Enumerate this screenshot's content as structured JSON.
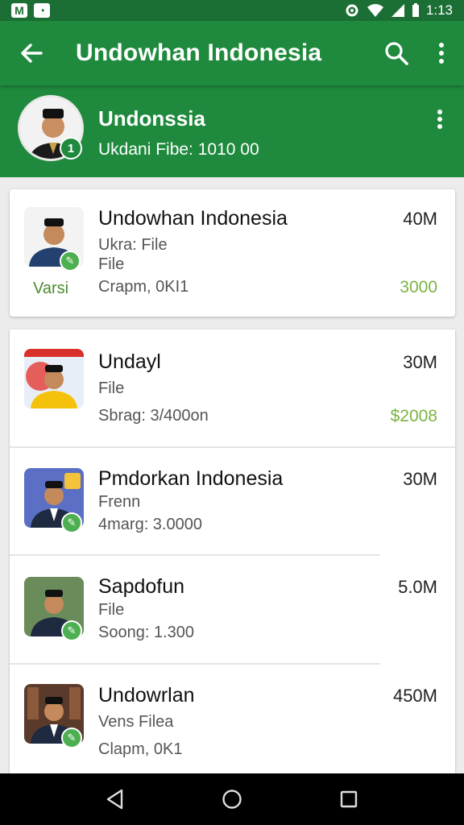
{
  "status_bar": {
    "left_icons": [
      "mail-icon",
      "whatsapp-icon"
    ],
    "time": "1:13"
  },
  "app_bar": {
    "title": "Undowhan Indonesia"
  },
  "profile": {
    "name": "Undonssia",
    "subtitle": "Ukdani Fibe: 1010 00",
    "badge": "1"
  },
  "featured": {
    "title": "Undowhan Indonesia",
    "line1": "Ukra: File",
    "line2": "File",
    "line3": "Crapm, 0KI1",
    "variant_label": "Varsi",
    "size": "40M",
    "price": "3000",
    "badge_icon": "share-icon"
  },
  "items": [
    {
      "title": "Undayl",
      "line1": "File",
      "line2": "Sbrag: 3/400on",
      "size": "30M",
      "price": "$2008"
    },
    {
      "title": "Pmdorkan Indonesia",
      "line1": "Frenn",
      "line2": "4marg: 3.0000",
      "size": "30M",
      "price": ""
    },
    {
      "title": "Sapdofun",
      "line1": "File",
      "line2": "Soong: 1.300",
      "size": "5.0M",
      "price": ""
    },
    {
      "title": "Undowrlan",
      "line1": "Vens Filea",
      "line2": "Clapm, 0K1",
      "size": "450M",
      "price": ""
    }
  ],
  "colors": {
    "status_bar": "#1b6f35",
    "app_bar": "#1f8a3d",
    "price_green": "#7cb342",
    "badge_green": "#4caf50"
  }
}
